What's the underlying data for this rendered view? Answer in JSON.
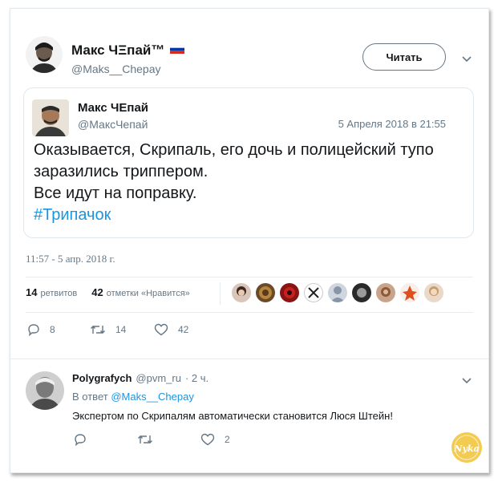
{
  "tweet": {
    "author_name": "Макс ЧΞпай™",
    "author_handle": "@Maks__Chepay",
    "follow_label": "Читать",
    "timestamp": "11:57 - 5 апр. 2018 г."
  },
  "quoted": {
    "author_name": "Макс ЧЕпай",
    "author_handle": "@МаксЧепай",
    "date": "5 Апреля 2018 в 21:55",
    "lines": [
      "Оказывается, Скрипаль, его дочь и полицейский тупо",
      "заразились триппером.",
      "Все идут на поправку."
    ],
    "hashtag": "#Трипачок"
  },
  "stats": {
    "retweets_count": "14",
    "retweets_label": "ретвитов",
    "likes_count": "42",
    "likes_label": "отметки «Нравится»"
  },
  "actions": {
    "reply_count": "8",
    "retweet_count": "14",
    "like_count": "42"
  },
  "reply": {
    "author_name": "Polygrafych",
    "author_handle": "@pvm_ru",
    "time": "· 2 ч.",
    "in_reply_prefix": "В ответ",
    "in_reply_handle": "@Maks__Chepay",
    "text": "Экспертом по Скрипалям автоматически становится Люся Штейн!",
    "like_count": "2"
  },
  "colors": {
    "link": "#1b95e0",
    "muted": "#657786",
    "text": "#14171a",
    "flag": [
      "#ffffff",
      "#0039a6",
      "#d52b1e"
    ]
  },
  "icons": [
    "chevron-down-icon",
    "reply-icon",
    "retweet-icon",
    "heart-icon",
    "flag-icon",
    "watermark-logo"
  ],
  "watermark": "Nyka"
}
